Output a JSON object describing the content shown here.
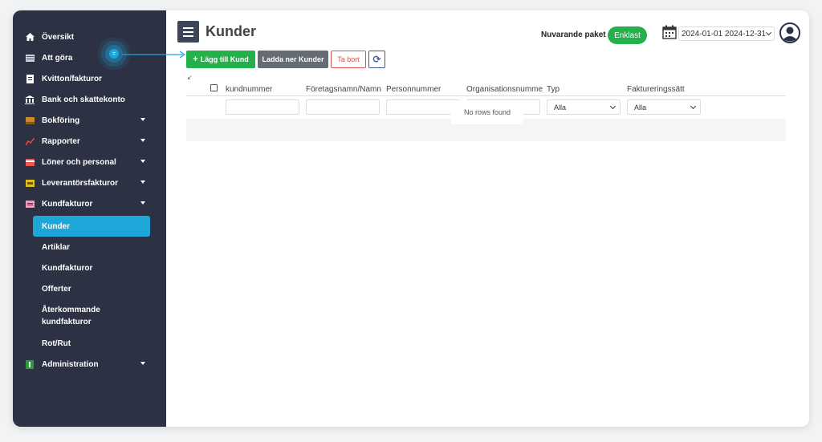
{
  "sidebar": {
    "items": [
      {
        "label": "Översikt",
        "icon": "home-icon"
      },
      {
        "label": "Att göra",
        "icon": "todo-icon"
      },
      {
        "label": "Kvitton/fakturor",
        "icon": "receipt-icon"
      },
      {
        "label": "Bank och skattekonto",
        "icon": "bank-icon"
      },
      {
        "label": "Bokföring",
        "icon": "book-icon"
      },
      {
        "label": "Rapporter",
        "icon": "chart-icon"
      },
      {
        "label": "Löner och personal",
        "icon": "card-icon"
      },
      {
        "label": "Leverantörsfakturor",
        "icon": "supplier-invoice-icon"
      },
      {
        "label": "Kundfakturor",
        "icon": "customer-invoice-icon"
      }
    ],
    "subitems": [
      {
        "label": "Kunder"
      },
      {
        "label": "Artiklar"
      },
      {
        "label": "Kundfakturor"
      },
      {
        "label": "Offerter"
      },
      {
        "label": "Återkommande kundfakturor"
      },
      {
        "label": "Rot/Rut"
      }
    ],
    "admin": {
      "label": "Administration",
      "icon": "admin-icon"
    }
  },
  "header": {
    "title": "Kunder",
    "package_label": "Nuvarande paket",
    "package_badge": "Enklast",
    "date_range": "2024-01-01 2024-12-31"
  },
  "toolbar": {
    "add_label": "Lägg till Kund",
    "download_label": "Ladda ner Kunder",
    "delete_label": "Ta bort",
    "refresh_symbol": "⟳"
  },
  "grid": {
    "columns": [
      "kundnummer",
      "Företagsnamn/Namn",
      "Personnummer",
      "Organisationsnumme",
      "Typ",
      "Faktureringssätt"
    ],
    "filters": {
      "typ": "Alla",
      "fakturering": "Alla"
    },
    "empty_text": "No rows found"
  },
  "colors": {
    "sidebar_bg": "#2c3244",
    "active": "#1fa6d9",
    "green": "#24b04a",
    "danger": "#d9534f"
  }
}
